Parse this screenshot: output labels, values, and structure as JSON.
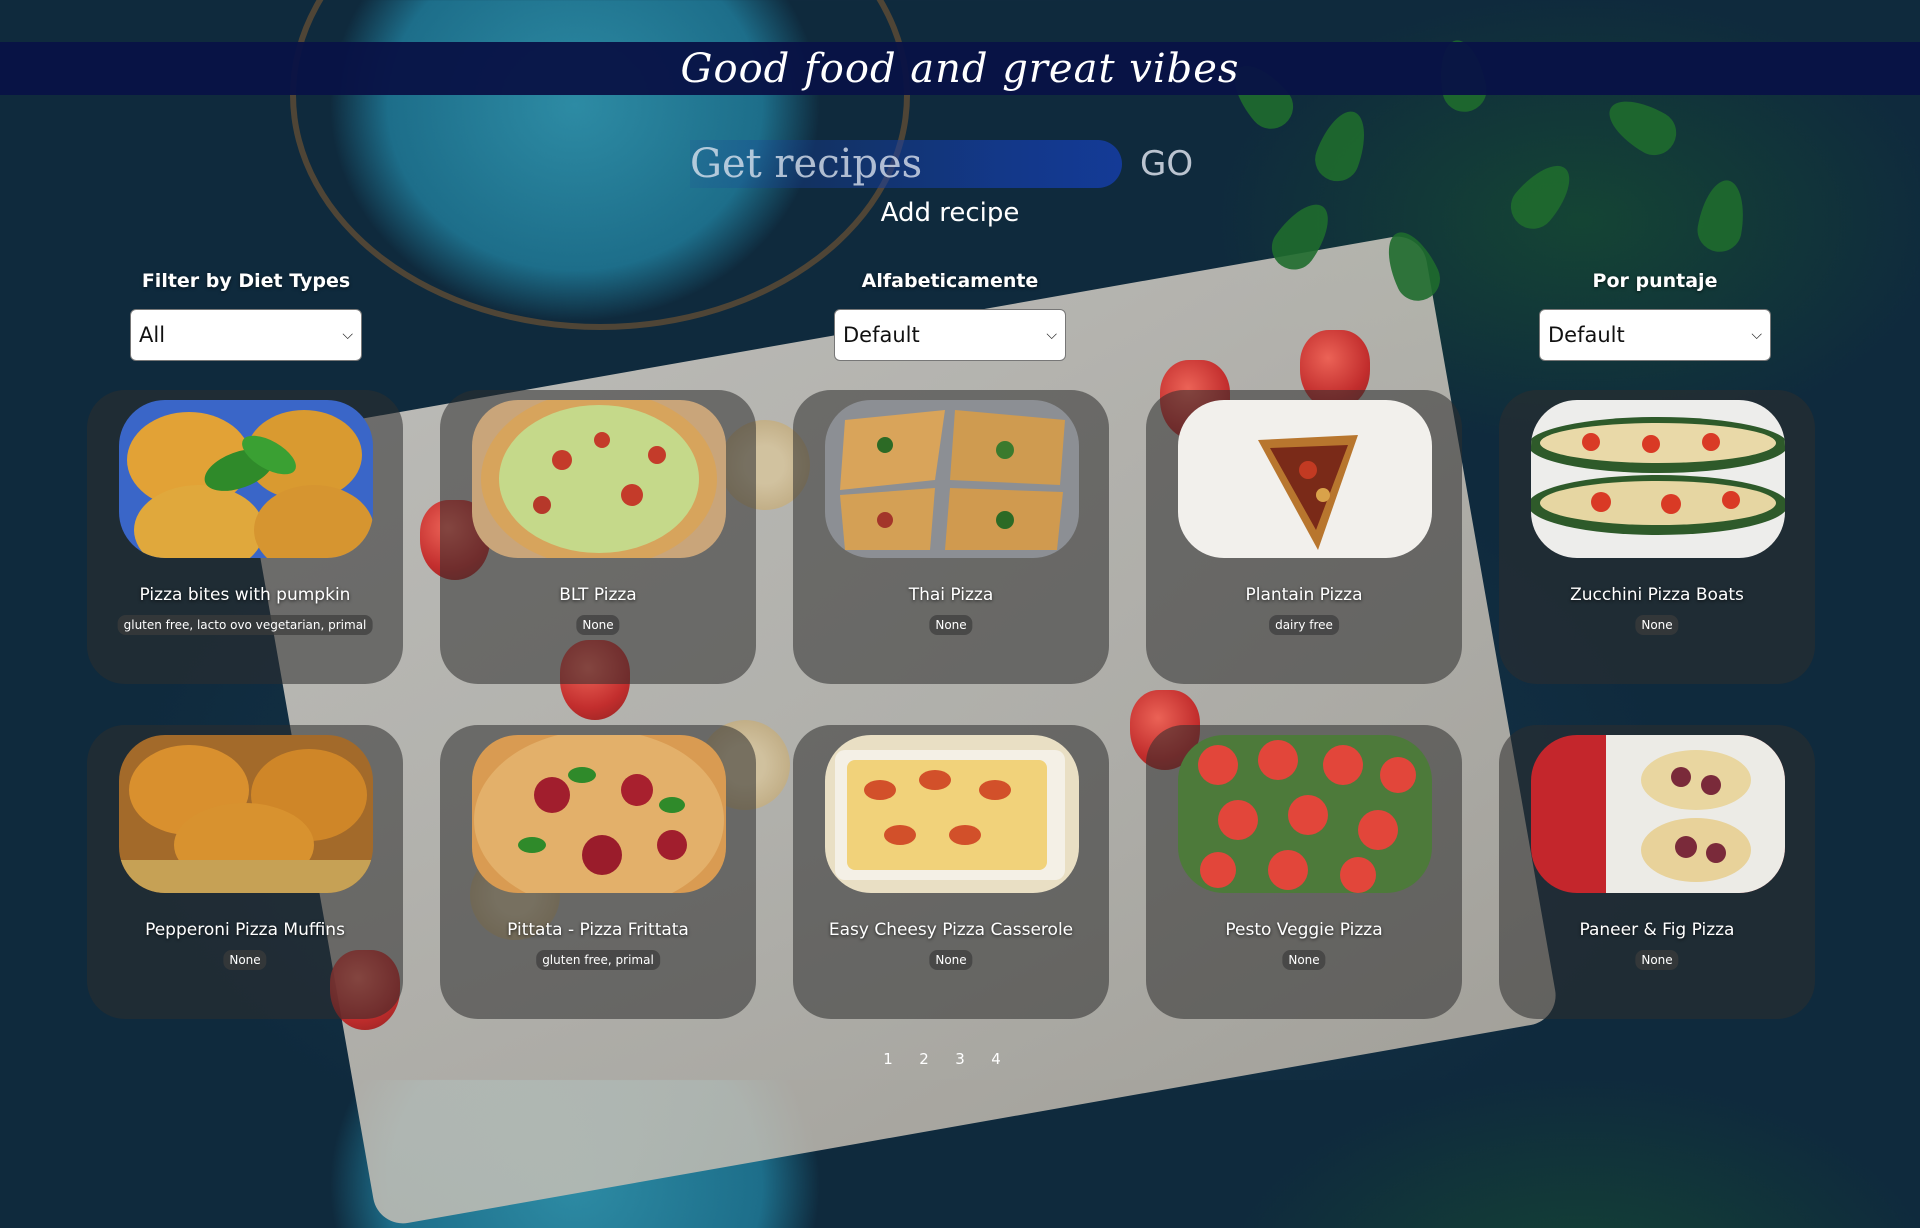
{
  "header": {
    "title": "Good food and great vibes"
  },
  "search": {
    "placeholder": "Get recipes",
    "value": "",
    "go_label": "GO"
  },
  "add_recipe_label": "Add recipe",
  "filters": [
    {
      "label": "Filter by Diet Types",
      "selected": "All"
    },
    {
      "label": "Alfabeticamente",
      "selected": "Default"
    },
    {
      "label": "Por puntaje",
      "selected": "Default"
    }
  ],
  "recipes": [
    {
      "name": "Pizza bites with pumpkin",
      "diets": "gluten free, lacto ovo vegetarian, primal",
      "icon": "pizza-bites-image"
    },
    {
      "name": "BLT Pizza",
      "diets": "None",
      "icon": "blt-pizza-image"
    },
    {
      "name": "Thai Pizza",
      "diets": "None",
      "icon": "thai-pizza-image"
    },
    {
      "name": "Plantain Pizza",
      "diets": "dairy free",
      "icon": "plantain-pizza-image"
    },
    {
      "name": "Zucchini Pizza Boats",
      "diets": "None",
      "icon": "zucchini-boats-image"
    },
    {
      "name": "Pepperoni Pizza Muffins",
      "diets": "None",
      "icon": "pepperoni-muffins-image"
    },
    {
      "name": "Pittata - Pizza Frittata",
      "diets": "gluten free, primal",
      "icon": "pittata-image"
    },
    {
      "name": "Easy Cheesy Pizza Casserole",
      "diets": "None",
      "icon": "cheesy-casserole-image"
    },
    {
      "name": "Pesto Veggie Pizza",
      "diets": "None",
      "icon": "pesto-veggie-image"
    },
    {
      "name": "Paneer & Fig Pizza",
      "diets": "None",
      "icon": "paneer-fig-image"
    }
  ],
  "pagination": [
    "1",
    "2",
    "3",
    "4"
  ]
}
